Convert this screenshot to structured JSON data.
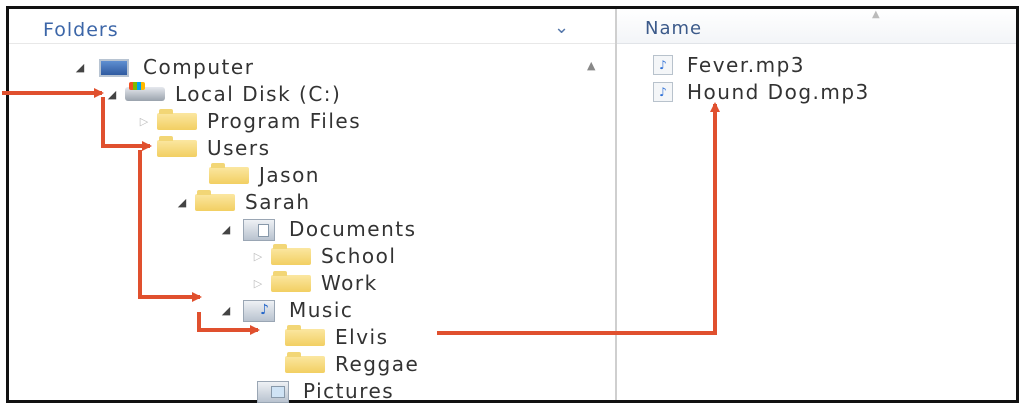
{
  "folders_pane": {
    "header": "Folders",
    "tree": [
      {
        "label": "Computer",
        "icon": "computer-icon",
        "expand": "open"
      },
      {
        "label": "Local Disk (C:)",
        "icon": "drive-icon",
        "expand": "open"
      },
      {
        "label": "Program Files",
        "icon": "folder-icon",
        "expand": "closed"
      },
      {
        "label": "Users",
        "icon": "folder-icon",
        "expand": "none"
      },
      {
        "label": "Jason",
        "icon": "folder-icon",
        "expand": "none"
      },
      {
        "label": "Sarah",
        "icon": "folder-icon",
        "expand": "open"
      },
      {
        "label": "Documents",
        "icon": "documents-library-icon",
        "expand": "open"
      },
      {
        "label": "School",
        "icon": "folder-icon",
        "expand": "closed"
      },
      {
        "label": "Work",
        "icon": "folder-icon",
        "expand": "closed"
      },
      {
        "label": "Music",
        "icon": "music-library-icon",
        "expand": "open"
      },
      {
        "label": "Elvis",
        "icon": "folder-icon",
        "expand": "none"
      },
      {
        "label": "Reggae",
        "icon": "folder-icon",
        "expand": "none"
      },
      {
        "label": "Pictures",
        "icon": "pictures-library-icon",
        "expand": "none"
      }
    ]
  },
  "files_pane": {
    "column_header": "Name",
    "files": [
      {
        "name": "Fever.mp3",
        "icon": "audio-file-icon"
      },
      {
        "name": "Hound Dog.mp3",
        "icon": "audio-file-icon"
      }
    ]
  },
  "colors": {
    "annotation_arrow": "#e0502e",
    "header_text": "#3c66a8"
  }
}
